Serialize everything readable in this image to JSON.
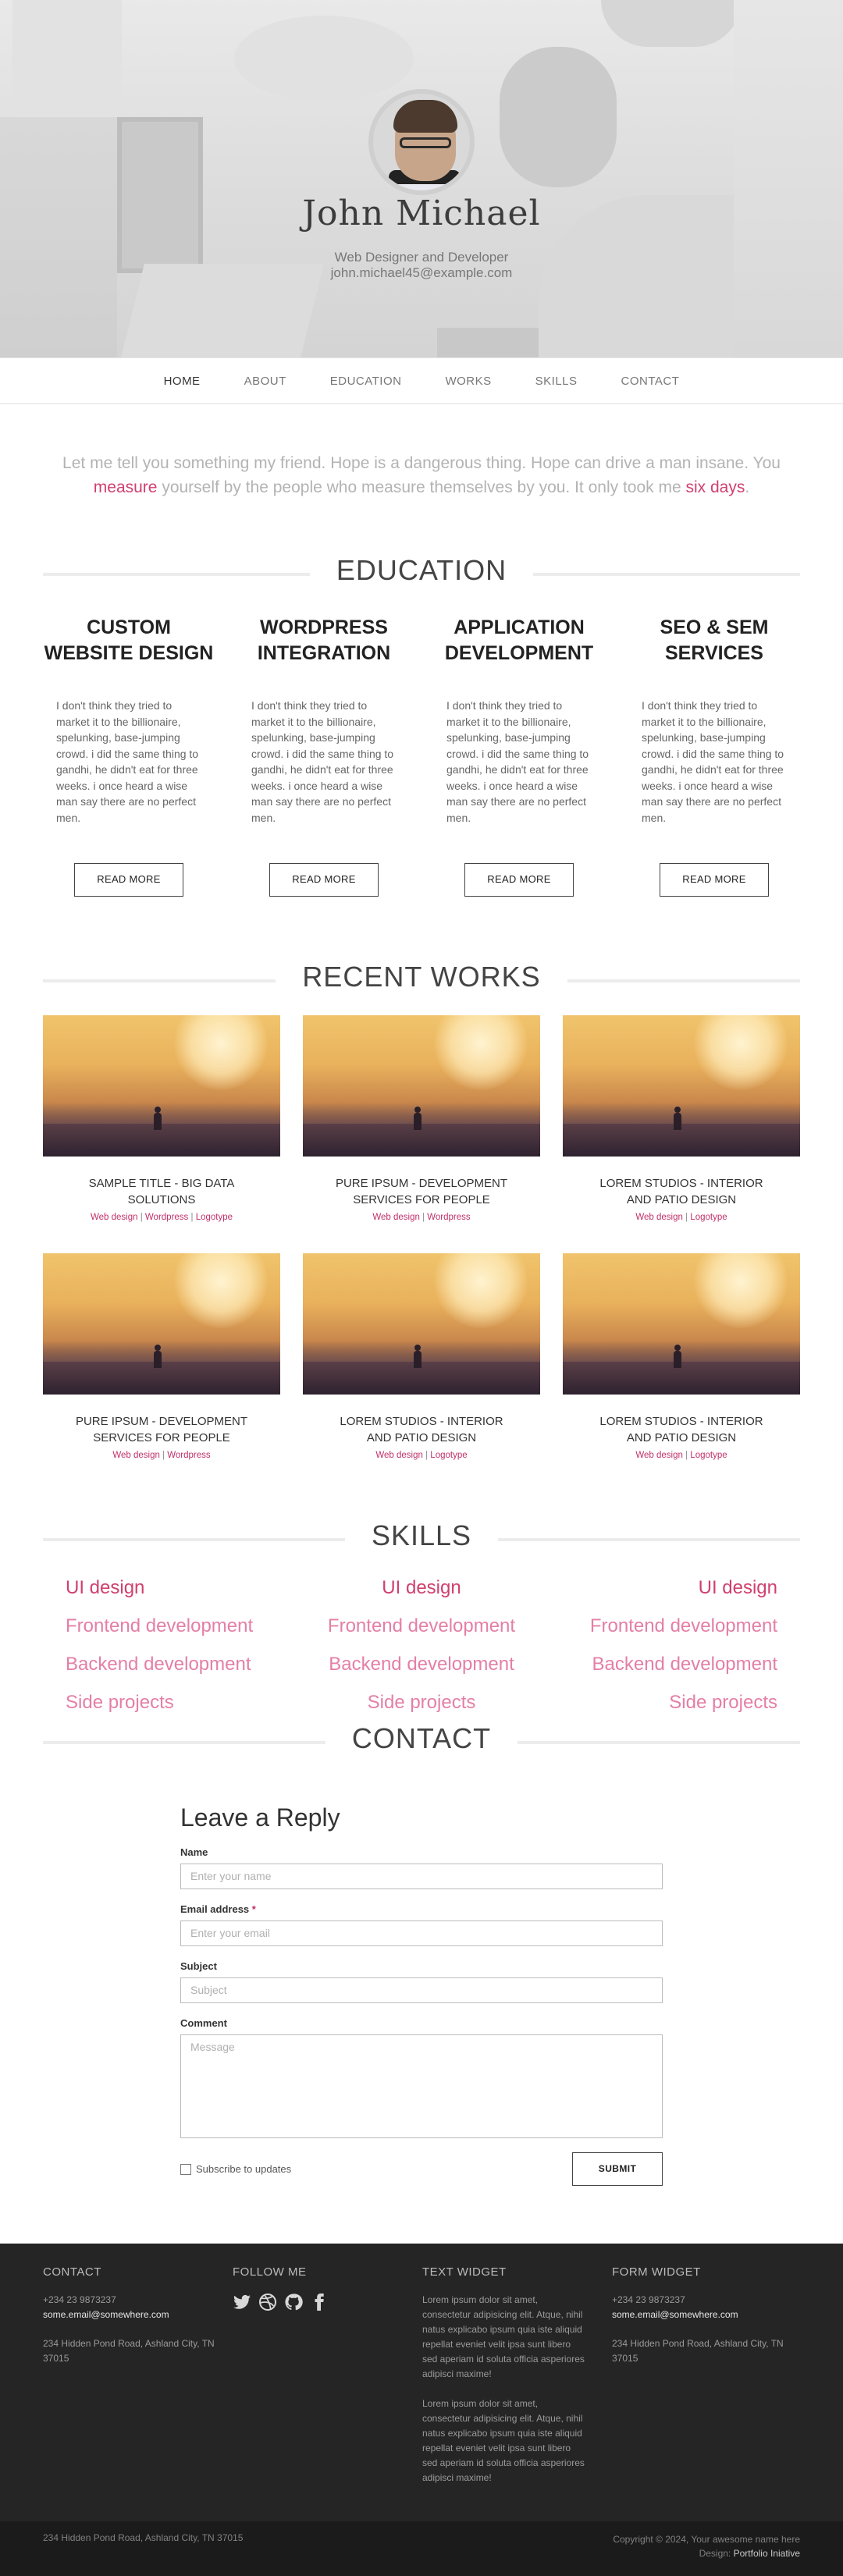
{
  "hero": {
    "name": "John Michael",
    "subtitle": "Web Designer and Developer",
    "email": "john.michael45@example.com"
  },
  "nav": {
    "items": [
      "HOME",
      "ABOUT",
      "EDUCATION",
      "WORKS",
      "SKILLS",
      "CONTACT"
    ],
    "active": "HOME"
  },
  "quote": {
    "part1": "Let me tell you something my friend. Hope is a dangerous thing. Hope can drive a man insane. You ",
    "hl1": "measure",
    "part2": " yourself by the people who measure themselves by you. It only took me ",
    "hl2": "six days",
    "part3": "."
  },
  "education": {
    "heading": "EDUCATION",
    "items": [
      {
        "title": "CUSTOM WEBSITE DESIGN",
        "text": "I don't think they tried to market it to the billionaire, spelunking, base-jumping crowd. i did the same thing to gandhi, he didn't eat for three weeks. i once heard a wise man say there are no perfect men.",
        "button": "READ MORE"
      },
      {
        "title": "WORDPRESS INTEGRATION",
        "text": "I don't think they tried to market it to the billionaire, spelunking, base-jumping crowd. i did the same thing to gandhi, he didn't eat for three weeks. i once heard a wise man say there are no perfect men.",
        "button": "READ MORE"
      },
      {
        "title": "APPLICATION DEVELOPMENT",
        "text": "I don't think they tried to market it to the billionaire, spelunking, base-jumping crowd. i did the same thing to gandhi, he didn't eat for three weeks. i once heard a wise man say there are no perfect men.",
        "button": "READ MORE"
      },
      {
        "title": "SEO & SEM SERVICES",
        "text": "I don't think they tried to market it to the billionaire, spelunking, base-jumping crowd. i did the same thing to gandhi, he didn't eat for three weeks. i once heard a wise man say there are no perfect men.",
        "button": "READ MORE"
      }
    ]
  },
  "works": {
    "heading": "RECENT WORKS",
    "items": [
      {
        "title": "SAMPLE TITLE - BIG DATA SOLUTIONS",
        "tags": [
          "Web design",
          "Wordpress",
          "Logotype"
        ]
      },
      {
        "title": "PURE IPSUM - DEVELOPMENT SERVICES FOR PEOPLE",
        "tags": [
          "Web design",
          "Wordpress"
        ]
      },
      {
        "title": "LOREM STUDIOS - INTERIOR AND PATIO DESIGN",
        "tags": [
          "Web design",
          "Logotype"
        ]
      },
      {
        "title": "PURE IPSUM - DEVELOPMENT SERVICES FOR PEOPLE",
        "tags": [
          "Web design",
          "Wordpress"
        ]
      },
      {
        "title": "LOREM STUDIOS - INTERIOR AND PATIO DESIGN",
        "tags": [
          "Web design",
          "Logotype"
        ]
      },
      {
        "title": "LOREM STUDIOS - INTERIOR AND PATIO DESIGN",
        "tags": [
          "Web design",
          "Logotype"
        ]
      }
    ]
  },
  "skills": {
    "heading": "SKILLS",
    "rows": [
      [
        "UI design",
        "UI design",
        "UI design"
      ],
      [
        "Frontend development",
        "Frontend development",
        "Frontend development"
      ],
      [
        "Backend development",
        "Backend development",
        "Backend development"
      ],
      [
        "Side projects",
        "Side projects",
        "Side projects"
      ]
    ]
  },
  "contact": {
    "heading": "CONTACT",
    "form_title": "Leave a Reply",
    "name_label": "Name",
    "name_placeholder": "Enter your name",
    "email_label": "Email address",
    "email_required": "*",
    "email_placeholder": "Enter your email",
    "subject_label": "Subject",
    "subject_placeholder": "Subject",
    "comment_label": "Comment",
    "comment_placeholder": "Message",
    "subscribe_label": "Subscribe to updates",
    "submit_label": "SUBMIT"
  },
  "footer": {
    "contact": {
      "heading": "CONTACT",
      "phone": "+234 23 9873237",
      "email": "some.email@somewhere.com",
      "address": "234 Hidden Pond Road, Ashland City, TN 37015"
    },
    "follow": {
      "heading": "FOLLOW ME",
      "icons": [
        "twitter-icon",
        "dribbble-icon",
        "github-icon",
        "facebook-icon"
      ]
    },
    "text_widget": {
      "heading": "TEXT WIDGET",
      "p1": "Lorem ipsum dolor sit amet, consectetur adipisicing elit. Atque, nihil natus explicabo ipsum quia iste aliquid repellat eveniet velit ipsa sunt libero sed aperiam id soluta officia asperiores adipisci maxime!",
      "p2": "Lorem ipsum dolor sit amet, consectetur adipisicing elit. Atque, nihil natus explicabo ipsum quia iste aliquid repellat eveniet velit ipsa sunt libero sed aperiam id soluta officia asperiores adipisci maxime!"
    },
    "form_widget": {
      "heading": "FORM WIDGET",
      "phone": "+234 23 9873237",
      "email": "some.email@somewhere.com",
      "address": "234 Hidden Pond Road, Ashland City, TN 37015"
    },
    "bottom_address": "234 Hidden Pond Road, Ashland City, TN 37015",
    "copyright": "Copyright © 2024, Your awesome name here",
    "design_label": "Design:",
    "design_link": "Portfolio Iniative"
  },
  "colors": {
    "accent": "#d0406f",
    "accent_light": "#e47fa5",
    "footer_bg": "#252525"
  }
}
